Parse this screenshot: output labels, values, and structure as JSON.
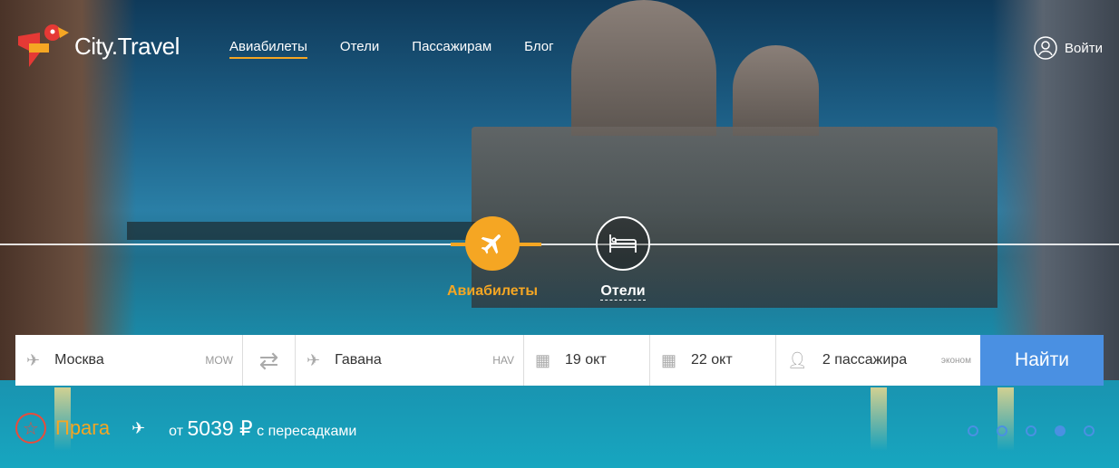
{
  "header": {
    "logo_text": "City.Travel",
    "nav": [
      "Авиабилеты",
      "Отели",
      "Пассажирам",
      "Блог"
    ],
    "login_label": "Войти"
  },
  "modes": [
    {
      "label": "Авиабилеты",
      "icon": "airplane-icon",
      "active": true
    },
    {
      "label": "Отели",
      "icon": "bed-icon",
      "active": false
    }
  ],
  "search": {
    "from_city": "Москва",
    "from_code": "MOW",
    "to_city": "Гавана",
    "to_code": "HAV",
    "depart_date": "19 окт",
    "return_date": "22 окт",
    "passengers": "2 пассажира",
    "class": "эконом",
    "submit_label": "Найти"
  },
  "promo": {
    "city": "Прага",
    "price_prefix": "от",
    "price": "5039 ₽",
    "suffix": "с пересадками"
  },
  "carousel": {
    "count": 5,
    "active_index": 3
  },
  "colors": {
    "accent": "#f5a623",
    "button": "#4a90e2",
    "star": "#e74c3c"
  }
}
